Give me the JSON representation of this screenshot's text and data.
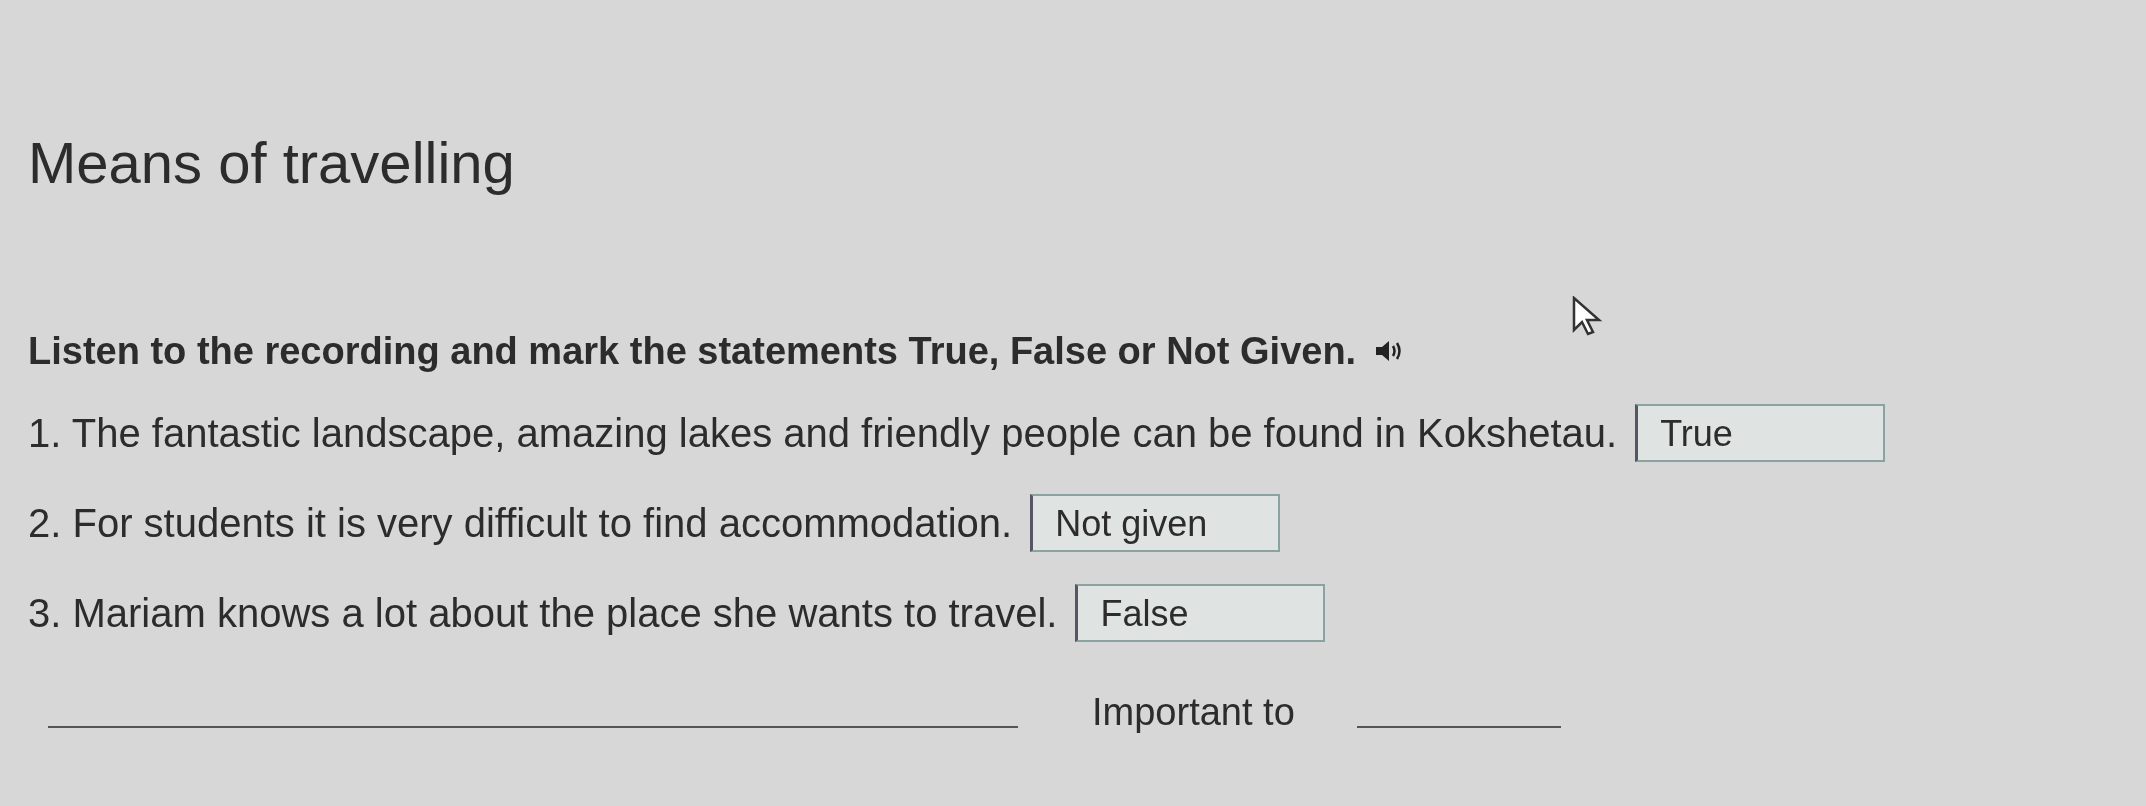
{
  "title": "Means of travelling",
  "instruction": "Listen to the recording and mark the statements True, False or Not Given.",
  "statements": [
    {
      "text": "1. The fantastic landscape, amazing lakes and friendly people can be found in Kokshetau.",
      "answer": "True"
    },
    {
      "text": "2. For students it is very difficult to find accommodation.",
      "answer": "Not given"
    },
    {
      "text": "3. Mariam knows a lot about the place she wants to travel.",
      "answer": "False"
    }
  ],
  "next_line": {
    "text": "Important to"
  }
}
